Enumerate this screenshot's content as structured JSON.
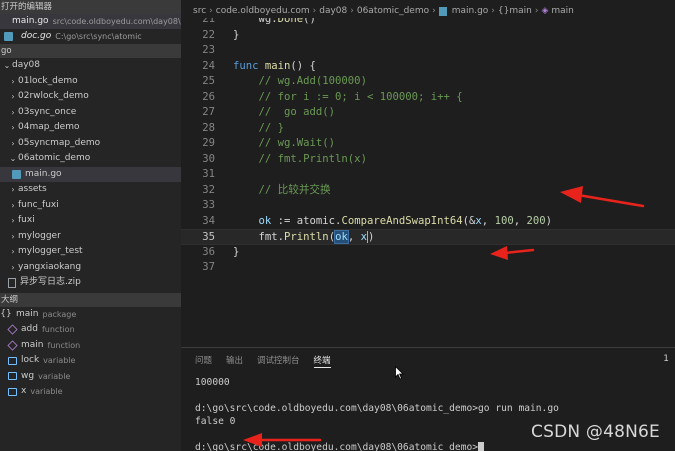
{
  "sidebar": {
    "open_editors_header": "打开的编辑器",
    "open_editors": [
      {
        "file": "main.go",
        "path": "src\\code.oldboyedu.com\\day08\\..."
      },
      {
        "file": "doc.go",
        "path": "C:\\go\\src\\sync\\atomic"
      }
    ],
    "folder_header": "go",
    "tree": [
      {
        "label": "day08",
        "chevron": "⌄"
      },
      {
        "label": "01lock_demo",
        "chevron": "›"
      },
      {
        "label": "02rwlock_demo",
        "chevron": "›"
      },
      {
        "label": "03sync_once",
        "chevron": "›"
      },
      {
        "label": "04map_demo",
        "chevron": "›"
      },
      {
        "label": "05syncmap_demo",
        "chevron": "›"
      },
      {
        "label": "06atomic_demo",
        "chevron": "⌄"
      },
      {
        "label": "main.go",
        "chevron": ""
      },
      {
        "label": "assets",
        "chevron": "›"
      },
      {
        "label": "func_fuxi",
        "chevron": "›"
      },
      {
        "label": "fuxi",
        "chevron": "›"
      },
      {
        "label": "mylogger",
        "chevron": "›"
      },
      {
        "label": "mylogger_test",
        "chevron": "›"
      },
      {
        "label": "yangxiaokang",
        "chevron": "›"
      },
      {
        "label": "异步写日志.zip",
        "chevron": ""
      }
    ],
    "outline_header": "大纲",
    "outline": [
      {
        "name": "main",
        "kind": "package"
      },
      {
        "name": "add",
        "kind": "function"
      },
      {
        "name": "main",
        "kind": "function"
      },
      {
        "name": "lock",
        "kind": "variable"
      },
      {
        "name": "wg",
        "kind": "variable"
      },
      {
        "name": "x",
        "kind": "variable"
      }
    ]
  },
  "breadcrumbs": [
    "src",
    "code.oldboyedu.com",
    "day08",
    "06atomic_demo",
    "main.go",
    "{}main",
    "main"
  ],
  "editor": {
    "lines": [
      {
        "n": "21",
        "text": "    wg.Done()"
      },
      {
        "n": "22",
        "text": "}"
      },
      {
        "n": "23",
        "text": ""
      },
      {
        "n": "24",
        "text": "func main() {"
      },
      {
        "n": "25",
        "text": "    // wg.Add(100000)"
      },
      {
        "n": "26",
        "text": "    // for i := 0; i < 100000; i++ {"
      },
      {
        "n": "27",
        "text": "    //  go add()"
      },
      {
        "n": "28",
        "text": "    // }"
      },
      {
        "n": "29",
        "text": "    // wg.Wait()"
      },
      {
        "n": "30",
        "text": "    // fmt.Println(x)"
      },
      {
        "n": "31",
        "text": ""
      },
      {
        "n": "32",
        "text": "    // 比较并交换"
      },
      {
        "n": "33",
        "text": ""
      },
      {
        "n": "34",
        "text": "    ok := atomic.CompareAndSwapInt64(&x, 100, 200)"
      },
      {
        "n": "35",
        "text": "    fmt.Println(ok, x)"
      },
      {
        "n": "36",
        "text": "}"
      },
      {
        "n": "37",
        "text": ""
      }
    ],
    "current_line": "35"
  },
  "panel": {
    "tabs": [
      "问题",
      "输出",
      "调试控制台",
      "终端"
    ],
    "active_tab": "终端",
    "right_label": "1",
    "terminal": [
      "100000",
      "",
      "d:\\go\\src\\code.oldboyedu.com\\day08\\06atomic_demo>go run main.go",
      "false 0",
      "",
      "d:\\go\\src\\code.oldboyedu.com\\day08\\06atomic_demo>"
    ]
  },
  "watermark": "CSDN @48N6E",
  "colors": {
    "annotation_arrow": "#e8231c",
    "accent": "#007acc"
  }
}
